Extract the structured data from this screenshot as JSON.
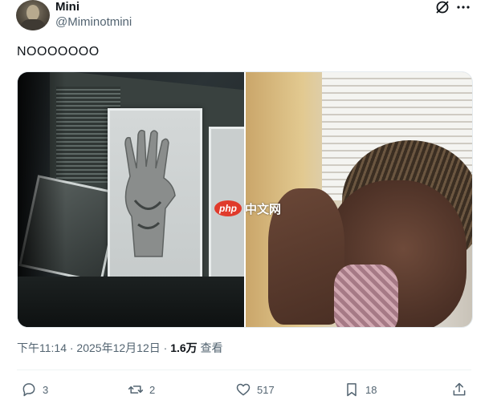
{
  "author": {
    "name": "Mini",
    "handle": "@Miminotmini"
  },
  "post": {
    "text": "NOOOOOOO",
    "media_watermark": {
      "badge": "php",
      "text": "中文网"
    },
    "timestamp": "下午11:14 · 2025年12月12日",
    "separator": " · ",
    "views_count": "1.6万",
    "views_label": "查看"
  },
  "actions": {
    "reply_count": "3",
    "repost_count": "2",
    "like_count": "517",
    "bookmark_count": "18"
  },
  "icons": [
    "grok-icon",
    "more-icon",
    "reply-icon",
    "repost-icon",
    "like-icon",
    "bookmark-icon",
    "share-icon"
  ],
  "colors": {
    "text": "#0f1419",
    "secondary": "#536471",
    "divider": "#eff3f4"
  }
}
